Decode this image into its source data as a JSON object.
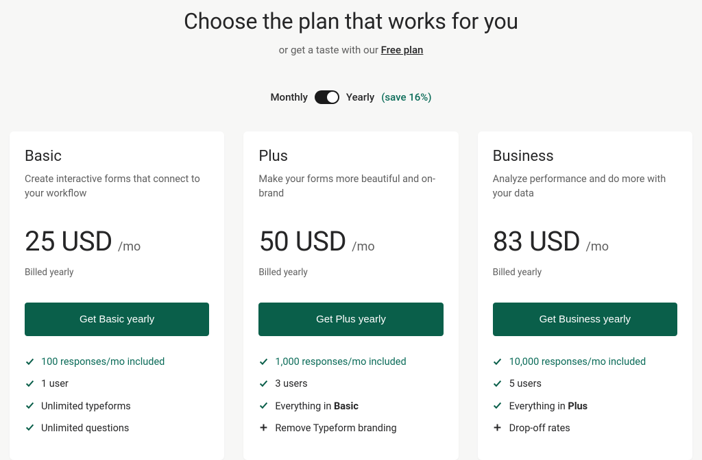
{
  "header": {
    "title": "Choose the plan that works for you",
    "subtext_prefix": "or get a taste with our ",
    "free_plan_link": "Free plan"
  },
  "billing": {
    "monthly_label": "Monthly",
    "yearly_label": "Yearly",
    "savings_text": "(save 16%)"
  },
  "plans": [
    {
      "name": "Basic",
      "description": "Create interactive forms that connect to your workflow",
      "price": "25 USD",
      "period": "/mo",
      "billed_note": "Billed yearly",
      "cta": "Get Basic yearly",
      "features": [
        {
          "icon": "check",
          "text": "100 responses/mo included",
          "highlighted": true
        },
        {
          "icon": "check",
          "text": "1 user"
        },
        {
          "icon": "check",
          "text": "Unlimited typeforms"
        },
        {
          "icon": "check",
          "text": "Unlimited questions"
        }
      ]
    },
    {
      "name": "Plus",
      "description": "Make your forms more beautiful and on-brand",
      "price": "50 USD",
      "period": "/mo",
      "billed_note": "Billed yearly",
      "cta": "Get Plus yearly",
      "features": [
        {
          "icon": "check",
          "text": "1,000 responses/mo included",
          "highlighted": true
        },
        {
          "icon": "check",
          "text": "3 users"
        },
        {
          "icon": "check",
          "text_prefix": "Everything in ",
          "text_bold": "Basic"
        },
        {
          "icon": "plus",
          "text": "Remove Typeform branding"
        }
      ]
    },
    {
      "name": "Business",
      "description": "Analyze performance and do more with your data",
      "price": "83 USD",
      "period": "/mo",
      "billed_note": "Billed yearly",
      "cta": "Get Business yearly",
      "features": [
        {
          "icon": "check",
          "text": "10,000 responses/mo included",
          "highlighted": true
        },
        {
          "icon": "check",
          "text": "5 users"
        },
        {
          "icon": "check",
          "text_prefix": "Everything in ",
          "text_bold": "Plus"
        },
        {
          "icon": "plus",
          "text": "Drop-off rates"
        }
      ]
    }
  ]
}
